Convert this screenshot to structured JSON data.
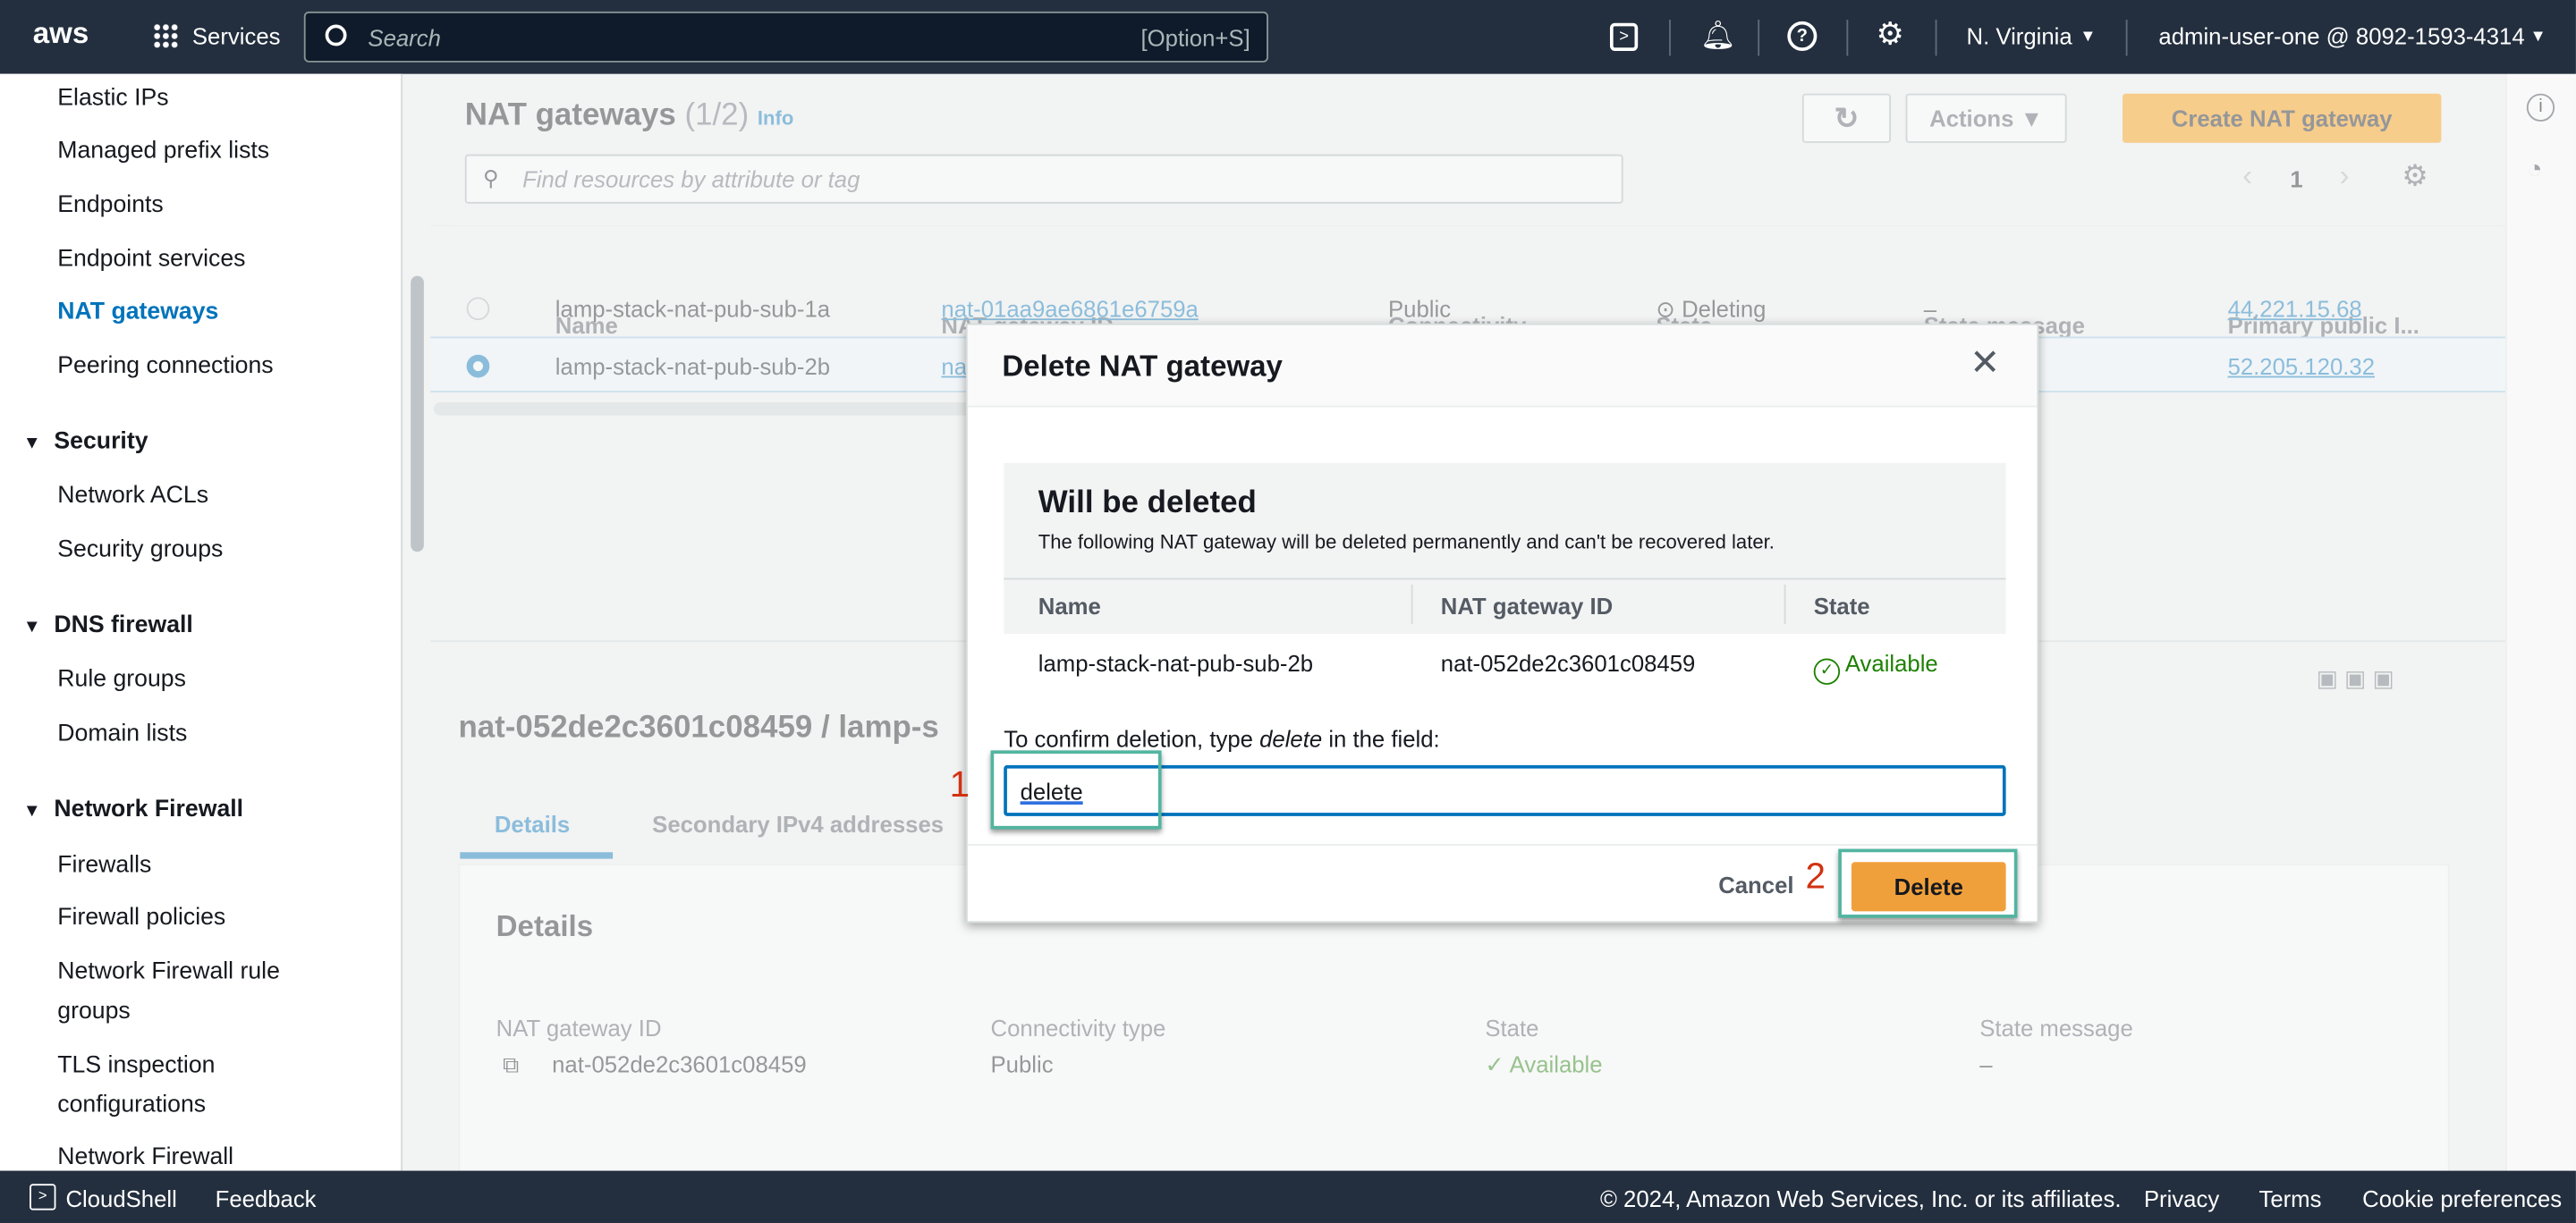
{
  "topbar": {
    "logo": "aws",
    "services": "Services",
    "search_placeholder": "Search",
    "search_shortcut": "[Option+S]",
    "region": "N. Virginia",
    "account": "admin-user-one @ 8092-1593-4314"
  },
  "sidebar": {
    "items": [
      "Elastic IPs",
      "Managed prefix lists",
      "Endpoints",
      "Endpoint services",
      "NAT gateways",
      "Peering connections"
    ],
    "security": {
      "title": "Security",
      "items": [
        "Network ACLs",
        "Security groups"
      ]
    },
    "dns": {
      "title": "DNS firewall",
      "items": [
        "Rule groups",
        "Domain lists"
      ]
    },
    "nfw": {
      "title": "Network Firewall",
      "items": [
        "Firewalls",
        "Firewall policies",
        "Network Firewall rule groups",
        "TLS inspection configurations",
        "Network Firewall"
      ]
    }
  },
  "main": {
    "title": "NAT gateways",
    "count": "(1/2)",
    "info": "Info",
    "actions": "Actions",
    "create": "Create NAT gateway",
    "filter_placeholder": "Find resources by attribute or tag",
    "page": "1",
    "columns": [
      "Name",
      "NAT gateway ID",
      "Connectivity...",
      "State",
      "State message",
      "Primary public I..."
    ],
    "rows": [
      {
        "name": "lamp-stack-nat-pub-sub-1a",
        "id": "nat-01aa9ae6861e6759a",
        "conn": "Public",
        "state": "Deleting",
        "msg": "–",
        "ip": "44.221.15.68"
      },
      {
        "name": "lamp-stack-nat-pub-sub-2b",
        "id": "nat-052de2c3601c08459",
        "conn": "",
        "state": "",
        "msg": "",
        "ip": "52.205.120.32"
      }
    ],
    "detail_title": "nat-052de2c3601c08459 / lamp-s",
    "tabs": [
      "Details",
      "Secondary IPv4 addresses"
    ],
    "details": {
      "heading": "Details",
      "labels": [
        "NAT gateway ID",
        "Connectivity type",
        "State",
        "State message"
      ],
      "values": [
        "nat-052de2c3601c08459",
        "Public",
        "Available",
        "–"
      ]
    }
  },
  "modal": {
    "title": "Delete NAT gateway",
    "heading": "Will be deleted",
    "description": "The following NAT gateway will be deleted permanently and can't be recovered later.",
    "columns": [
      "Name",
      "NAT gateway ID",
      "State"
    ],
    "row": {
      "name": "lamp-stack-nat-pub-sub-2b",
      "id": "nat-052de2c3601c08459",
      "state": "Available"
    },
    "confirm_pre": "To confirm deletion, type ",
    "confirm_word": "delete",
    "confirm_post": " in the field:",
    "input_value": "delete",
    "cancel": "Cancel",
    "delete": "Delete"
  },
  "annotations": [
    "1",
    "2"
  ],
  "footer": {
    "cloudshell": "CloudShell",
    "feedback": "Feedback",
    "copyright": "© 2024, Amazon Web Services, Inc. or its affiliates.",
    "privacy": "Privacy",
    "terms": "Terms",
    "cookies": "Cookie preferences"
  },
  "colors": {
    "topbar": "#232f3e",
    "accent": "#0073bb",
    "primary": "#f0a03b",
    "success": "#1d8102",
    "annotation": "#52b5a0"
  }
}
